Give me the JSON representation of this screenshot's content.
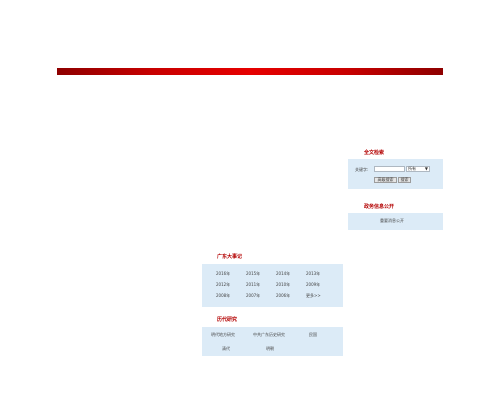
{
  "search": {
    "heading": "全文检索",
    "keyword_label": "关键字:",
    "keyword_value": "",
    "scope_selected": "所有",
    "advanced_button": "高级搜索",
    "search_button": "搜索"
  },
  "disclosure": {
    "heading": "政务信息公开",
    "link": "重要消息公开"
  },
  "events": {
    "heading": "广东大事记",
    "years": [
      "2016年",
      "2015年",
      "2014年",
      "2013年",
      "2012年",
      "2011年",
      "2010年",
      "2009年",
      "2008年",
      "2007年",
      "2006年",
      "更多>>"
    ]
  },
  "history": {
    "heading": "历代研究",
    "links": [
      "明代地方研究",
      "中共广东历史研究",
      "民国",
      "清代",
      "明朝"
    ]
  }
}
